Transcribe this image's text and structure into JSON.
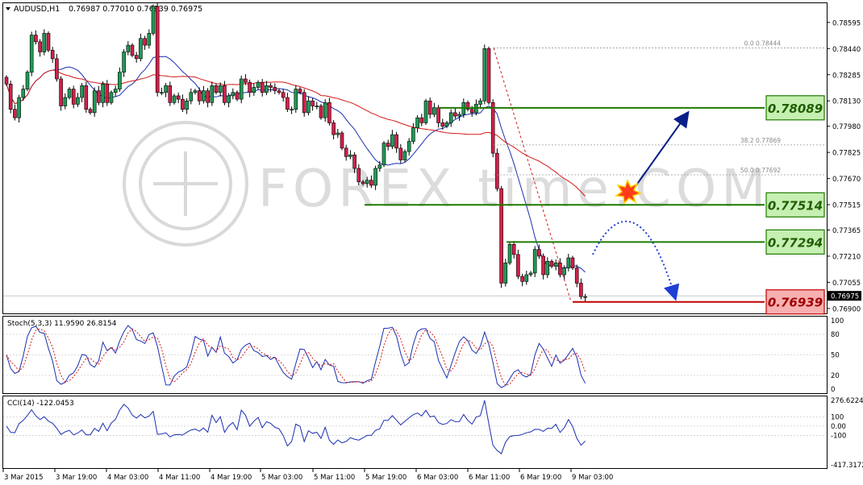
{
  "header": {
    "symbol_label": "AUDUSD,H1",
    "ohlc": "0.76987 0.77010 0.76939 0.76975"
  },
  "watermark": "FOREX time.COM",
  "price_axis": {
    "ticks": [
      "0.78595",
      "0.78440",
      "0.78285",
      "0.78130",
      "0.77980",
      "0.77825",
      "0.77670",
      "0.77515",
      "0.77365",
      "0.77210",
      "0.77055",
      "0.76900"
    ],
    "current_price": "0.76975"
  },
  "fibonacci": [
    {
      "label": "0.0  0.78444"
    },
    {
      "label": "38.2  0.77869"
    },
    {
      "label": "50.0  0.77692"
    }
  ],
  "levels": [
    {
      "label": "0.78089",
      "value": 0.78089,
      "kind": "resistance",
      "color": "#1f7a00",
      "fill": "#c6efb2"
    },
    {
      "label": "0.77514",
      "value": 0.77514,
      "kind": "resistance",
      "color": "#1f7a00",
      "fill": "#c6efb2"
    },
    {
      "label": "0.77294",
      "value": 0.77294,
      "kind": "resistance",
      "color": "#1f7a00",
      "fill": "#c6efb2"
    },
    {
      "label": "0.76939",
      "value": 0.76939,
      "kind": "support",
      "color": "#c00000",
      "fill": "#f7b0b0"
    }
  ],
  "stochastic": {
    "label": "Stoch(5,3,3) 11.9590 26.8154",
    "ticks": [
      "100",
      "80",
      "50",
      "20",
      "0"
    ]
  },
  "cci": {
    "label": "CCI(14) -122.0453",
    "ticks": [
      "276.6224",
      "100",
      "0.00",
      "-100",
      "-417.3172"
    ]
  },
  "time_axis": [
    "3 Mar 2015",
    "3 Mar 19:00",
    "4 Mar 03:00",
    "4 Mar 11:00",
    "4 Mar 19:00",
    "5 Mar 03:00",
    "5 Mar 11:00",
    "5 Mar 19:00",
    "6 Mar 03:00",
    "6 Mar 11:00",
    "6 Mar 19:00",
    "9 Mar 03:00"
  ],
  "chart_data": {
    "type": "line",
    "title": "AUDUSD,H1",
    "price_series": {
      "name": "AUDUSD,H1",
      "close": [
        0.7823,
        0.7808,
        0.7803,
        0.7815,
        0.782,
        0.783,
        0.7852,
        0.7848,
        0.7842,
        0.7853,
        0.7843,
        0.7838,
        0.7826,
        0.781,
        0.7815,
        0.782,
        0.7811,
        0.7815,
        0.7822,
        0.7808,
        0.7806,
        0.7819,
        0.7812,
        0.7823,
        0.7812,
        0.7818,
        0.782,
        0.783,
        0.7842,
        0.7846,
        0.784,
        0.7838,
        0.785,
        0.7846,
        0.7853,
        0.7869,
        0.7818,
        0.7818,
        0.7822,
        0.7812,
        0.7816,
        0.7814,
        0.7808,
        0.7813,
        0.7818,
        0.7819,
        0.7813,
        0.7819,
        0.7812,
        0.7822,
        0.7818,
        0.7822,
        0.7812,
        0.7816,
        0.7818,
        0.7814,
        0.7826,
        0.7824,
        0.7818,
        0.7821,
        0.7824,
        0.7818,
        0.7822,
        0.7821,
        0.7819,
        0.7818,
        0.7815,
        0.7808,
        0.7808,
        0.782,
        0.7818,
        0.7806,
        0.7813,
        0.781,
        0.781,
        0.7803,
        0.7812,
        0.78,
        0.7793,
        0.7794,
        0.7785,
        0.778,
        0.7781,
        0.7773,
        0.7765,
        0.7764,
        0.7766,
        0.7763,
        0.7773,
        0.7775,
        0.7788,
        0.7786,
        0.7793,
        0.7785,
        0.7778,
        0.7783,
        0.7789,
        0.7797,
        0.7803,
        0.78,
        0.7813,
        0.7805,
        0.7809,
        0.78,
        0.7798,
        0.78,
        0.7806,
        0.7804,
        0.7805,
        0.7812,
        0.7808,
        0.7806,
        0.7811,
        0.7813,
        0.7844,
        0.7812,
        0.7782,
        0.7761,
        0.7705,
        0.7717,
        0.7728,
        0.7722,
        0.7709,
        0.7706,
        0.771,
        0.7711,
        0.7725,
        0.7721,
        0.771,
        0.7718,
        0.7715,
        0.7717,
        0.771,
        0.7714,
        0.772,
        0.7714,
        0.7705,
        0.7697,
        0.7697
      ],
      "start_index": 0
    },
    "indicators": [
      "Moving Average (fast)",
      "Moving Average (slow)",
      "Stochastic(5,3,3)",
      "CCI(14)"
    ],
    "stochastic": {
      "k": 11.959,
      "d": 26.8154,
      "range": [
        0,
        100
      ],
      "levels": [
        20,
        50,
        80
      ]
    },
    "cci": {
      "value": -122.0453,
      "range": [
        -417.3172,
        276.6224
      ],
      "levels": [
        -100,
        0,
        100
      ]
    },
    "ylim": [
      0.769,
      0.7868
    ],
    "xlabel": "",
    "ylabel": ""
  }
}
